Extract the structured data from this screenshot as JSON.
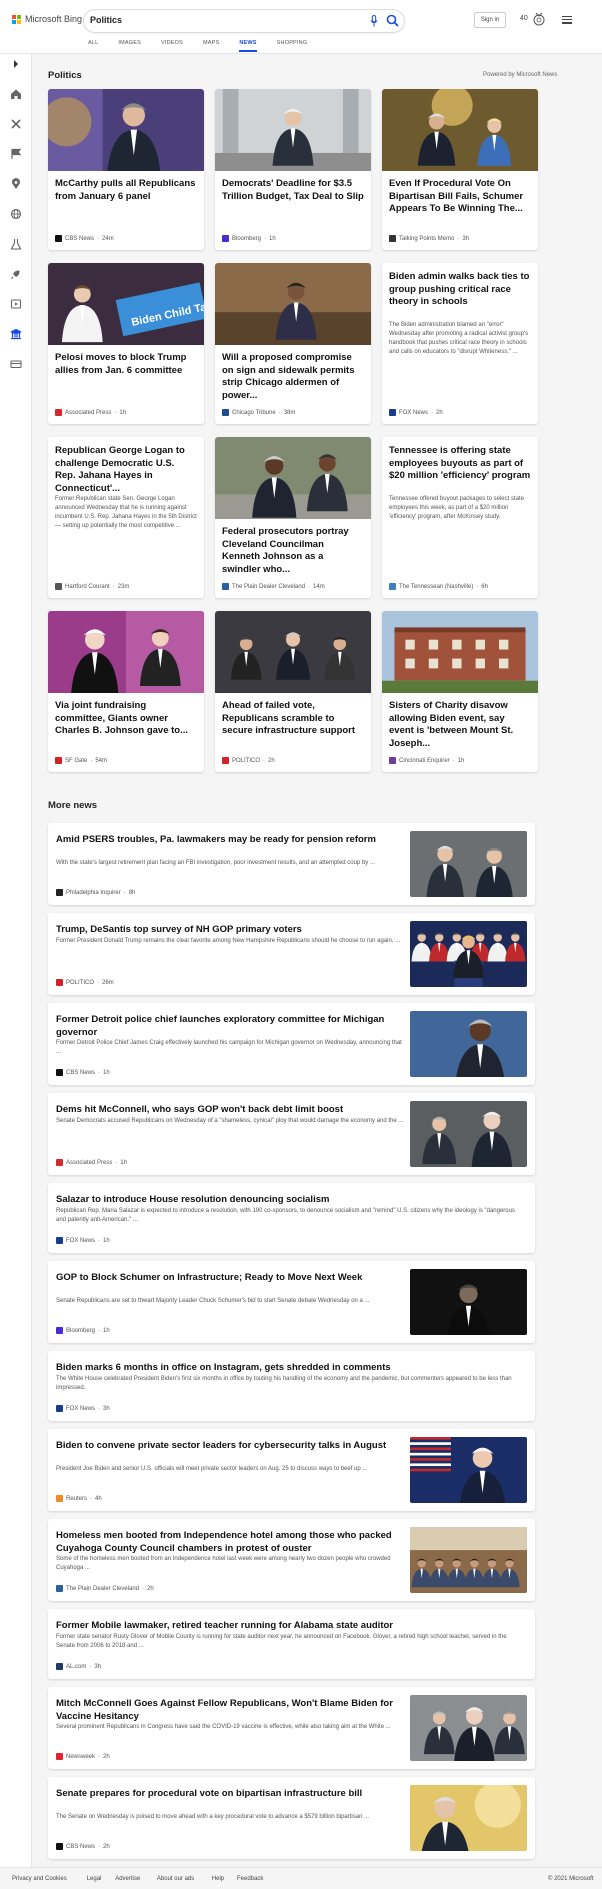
{
  "header": {
    "logo_text": "Microsoft Bing",
    "search_value": "Politics",
    "signin_label": "Sign in",
    "points": "40",
    "tabs": [
      {
        "label": "ALL"
      },
      {
        "label": "IMAGES"
      },
      {
        "label": "VIDEOS"
      },
      {
        "label": "MAPS"
      },
      {
        "label": "NEWS"
      },
      {
        "label": "SHOPPING"
      }
    ],
    "active_tab": "NEWS",
    "accent_color": "#174ae4"
  },
  "sidebar": {
    "icons": [
      "chevron-right-icon",
      "home-icon",
      "sports-icon",
      "flag-icon",
      "location-icon",
      "globe-icon",
      "science-icon",
      "rocket-icon",
      "entertainment-icon",
      "politics-icon",
      "money-icon"
    ]
  },
  "main": {
    "section_title": "Politics",
    "powered_by": "Powered by Microsoft News",
    "cards": [
      {
        "title": "McCarthy pulls all Republicans from January 6 panel",
        "snippet": "",
        "source": "CBS News",
        "time": "24m",
        "source_color": "#111111",
        "image": "photo-mccarthy"
      },
      {
        "title": "Democrats' Deadline for $3.5 Trillion Budget, Tax Deal to Slip",
        "snippet": "",
        "source": "Bloomberg",
        "time": "1h",
        "source_color": "#4b2bd6",
        "image": "photo-sanders"
      },
      {
        "title": "Even If Procedural Vote On Bipartisan Bill Fails, Schumer Appears To Be Winning The...",
        "snippet": "",
        "source": "Talking Points Memo",
        "time": "3h",
        "source_color": "#333333",
        "image": "photo-schumer"
      },
      {
        "title": "Pelosi moves to block Trump allies from Jan. 6 committee",
        "snippet": "",
        "source": "Associated Press",
        "time": "1h",
        "source_color": "#d22a2a",
        "image": "photo-pelosi"
      },
      {
        "title": "Will a proposed compromise on sign and sidewalk permits strip Chicago aldermen of power...",
        "snippet": "",
        "source": "Chicago Tribune",
        "time": "38m",
        "source_color": "#1c4d8c",
        "image": "photo-chicago"
      },
      {
        "title": "Biden admin walks back ties to group pushing critical race theory in schools",
        "snippet": "The Biden administration blamed an \"error\" Wednesday after promoting a radical activist group's handbook that pushes critical race theory in schools and calls on educators to \"disrupt Whiteness.\" ...",
        "source": "FOX News",
        "time": "2h",
        "source_color": "#1a3b8c",
        "image": ""
      },
      {
        "title": "Republican George Logan to challenge Democratic U.S. Rep. Jahana Hayes in Connecticut'...",
        "snippet": "Former Republican state Sen. George Logan announced Wednesday that he is running against incumbent U.S. Rep. Jahana Hayes in the 5th District — setting up potentially the most competitive ...",
        "source": "Hartford Courant",
        "time": "23m",
        "source_color": "#555555",
        "image": ""
      },
      {
        "title": "Federal prosecutors portray Cleveland Councilman Kenneth Johnson as a swindler who...",
        "snippet": "",
        "source": "The Plain Dealer Cleveland",
        "time": "14m",
        "source_color": "#2b5f9e",
        "image": "photo-cleveland"
      },
      {
        "title": "Tennessee is offering state employees buyouts as part of $20 million 'efficiency' program",
        "snippet": "Tennessee offered buyout packages to select state employees this week, as part of a $20 million 'efficiency' program, after McKinsey study.",
        "source": "The Tennessean (Nashville)",
        "time": "6h",
        "source_color": "#3f7fbf",
        "image": ""
      },
      {
        "title": "Via joint fundraising committee, Giants owner Charles B. Johnson gave to...",
        "snippet": "",
        "source": "SF Gate",
        "time": "54m",
        "source_color": "#d2232a",
        "image": "photo-giants"
      },
      {
        "title": "Ahead of failed vote, Republicans scramble to secure infrastructure support",
        "snippet": "",
        "source": "POLITICO",
        "time": "2h",
        "source_color": "#d2232a",
        "image": "photo-capitol-crowd"
      },
      {
        "title": "Sisters of Charity disavow allowing Biden event, say event is 'between Mount St. Joseph...",
        "snippet": "",
        "source": "Cincinnati Enquirer",
        "time": "1h",
        "source_color": "#6b3fa0",
        "image": "photo-building"
      }
    ],
    "more_title": "More news",
    "more_news": [
      {
        "title": "Amid PSERS troubles, Pa. lawmakers may be ready for pension reform",
        "snippet": "With the state's largest retirement plan facing an FBI investigation, poor investment results, and an attempted coup by ...",
        "source": "Philadelphia Inquirer",
        "time": "8h",
        "source_color": "#222222",
        "image": "photo-lawmakers"
      },
      {
        "title": "Trump, DeSantis top survey of NH GOP primary voters",
        "snippet": "Former President Donald Trump remains the clear favorite among New Hampshire Republicans should he choose to run again, ...",
        "source": "POLITICO",
        "time": "26m",
        "source_color": "#d2232a",
        "image": "photo-rally"
      },
      {
        "title": "Former Detroit police chief launches exploratory committee for Michigan governor",
        "snippet": "Former Detroit Police Chief James Craig effectively launched his campaign for Michigan governor on Wednesday, announcing that ...",
        "source": "CBS News",
        "time": "1h",
        "source_color": "#111111",
        "image": "photo-craig"
      },
      {
        "title": "Dems hit McConnell, who says GOP won't back debt limit boost",
        "snippet": "Senate Democrats accused Republicans on Wednesday of a \"shameless, cynical\" ploy that would damage the economy and the ...",
        "source": "Associated Press",
        "time": "1h",
        "source_color": "#d22a2a",
        "image": "photo-mcconnell-hall"
      },
      {
        "title": "Salazar to introduce House resolution denouncing socialism",
        "snippet": "Republican Rep. Maria Salazar is expected to introduce a resolution, with 190 co-sponsors, to denounce socialism and \"remind\" U.S. citizens why the ideology is \"dangerous and patently anti-American.\" ...",
        "source": "FOX News",
        "time": "1h",
        "source_color": "#1a3b8c",
        "image": ""
      },
      {
        "title": "GOP to Block Schumer on Infrastructure; Ready to Move Next Week",
        "snippet": "Senate Republicans are set to thwart Majority Leader Chuck Schumer's bid to start Senate debate Wednesday on a ...",
        "source": "Bloomberg",
        "time": "1h",
        "source_color": "#4b2bd6",
        "image": "photo-schumer-dark"
      },
      {
        "title": "Biden marks 6 months in office on Instagram, gets shredded in comments",
        "snippet": "The White House celebrated President Biden's first six months in office by touting his handling of the economy and the pandemic, but commenters appeared to be less than impressed.",
        "source": "FOX News",
        "time": "3h",
        "source_color": "#1a3b8c",
        "image": ""
      },
      {
        "title": "Biden to convene private sector leaders for cybersecurity talks in August",
        "snippet": "President Joe Biden and senior U.S. officials will meet private sector leaders on Aug. 25 to discuss ways to beef up ...",
        "source": "Reuters",
        "time": "4h",
        "source_color": "#f08a24",
        "image": "photo-biden"
      },
      {
        "title": "Homeless men booted from Independence hotel among those who packed Cuyahoga County Council chambers in protest of ouster",
        "snippet": "Some of the homeless men booted from an Independence hotel last week were among nearly two dozen people who crowded Cuyahoga ...",
        "source": "The Plain Dealer Cleveland",
        "time": "2h",
        "source_color": "#2b5f9e",
        "image": "photo-council"
      },
      {
        "title": "Former Mobile lawmaker, retired teacher running for Alabama state auditor",
        "snippet": "Former state senator Rusty Glover of Mobile County is running for state auditor next year, he announced on Facebook. Glover, a retired high school teacher, served in the Senate from 2006 to 2018 and ...",
        "source": "AL.com",
        "time": "3h",
        "source_color": "#1f3b63",
        "image": ""
      },
      {
        "title": "Mitch McConnell Goes Against Fellow Republicans, Won't Blame Biden for Vaccine Hesitancy",
        "snippet": "Several prominent Republicans in Congress have said the COVID-19 vaccine is effective, while also taking aim at the White ...",
        "source": "Newsweek",
        "time": "2h",
        "source_color": "#e0262d",
        "image": "photo-mcconnell-group"
      },
      {
        "title": "Senate prepares for procedural vote on bipartisan infrastructure bill",
        "snippet": "The Senate on Wednesday is poised to move ahead with a key procedural vote to advance a $579 billion bipartisan ...",
        "source": "CBS News",
        "time": "2h",
        "source_color": "#111111",
        "image": "photo-senator-gold"
      }
    ]
  },
  "footer": {
    "links": [
      "Privacy and Cookies",
      "Legal",
      "Advertise",
      "About our ads",
      "Help",
      "Feedback"
    ],
    "copyright": "© 2021 Microsoft"
  }
}
